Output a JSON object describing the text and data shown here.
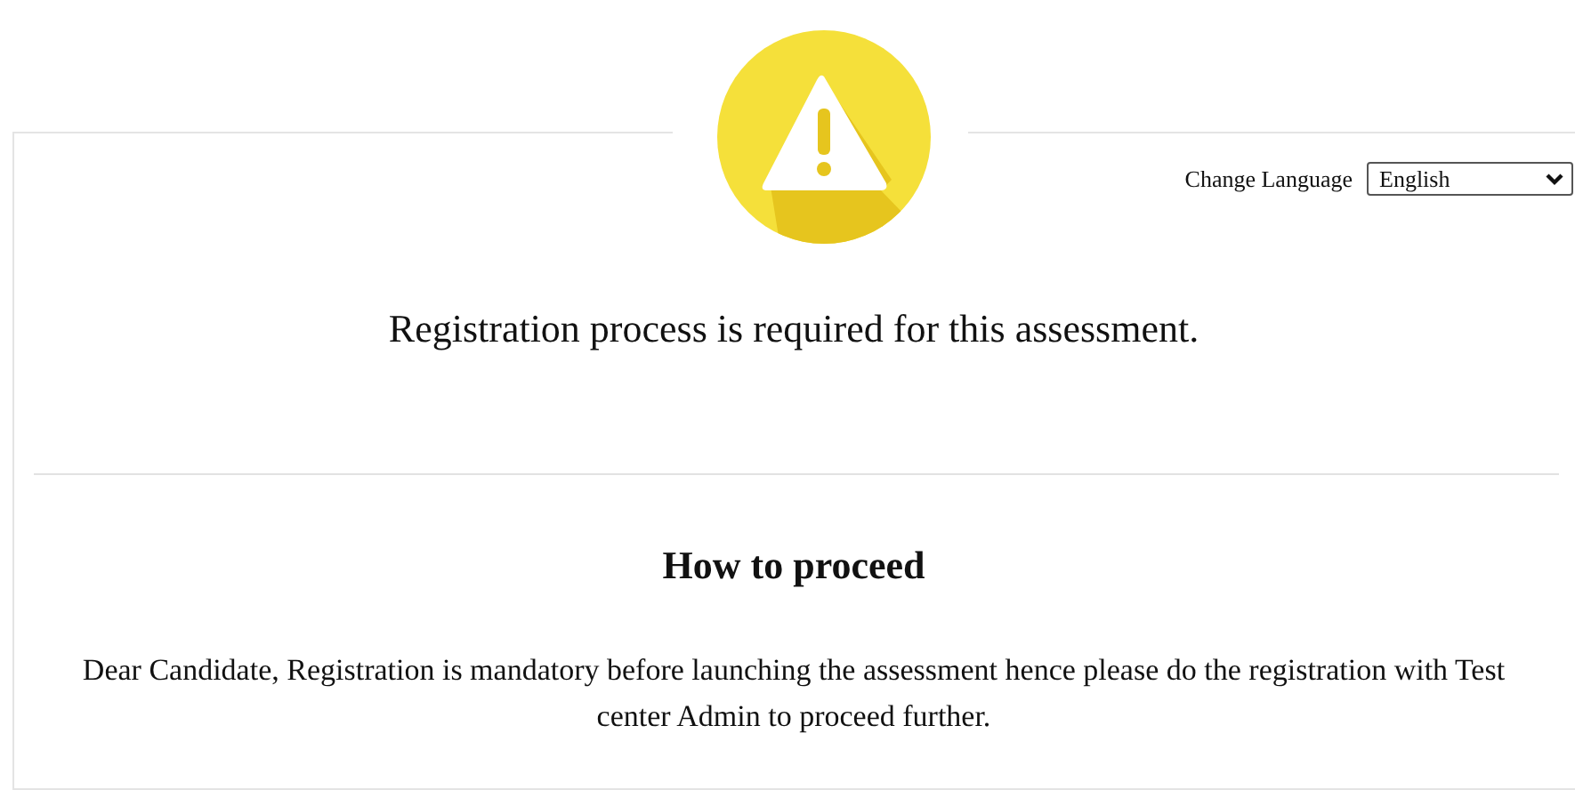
{
  "language": {
    "label": "Change Language",
    "value": "English"
  },
  "message": "Registration process is required for this assessment.",
  "section": {
    "heading": "How to proceed",
    "text": "Dear Candidate, Registration is mandatory before launching the assessment hence please do the registration with Test center Admin to proceed further."
  }
}
